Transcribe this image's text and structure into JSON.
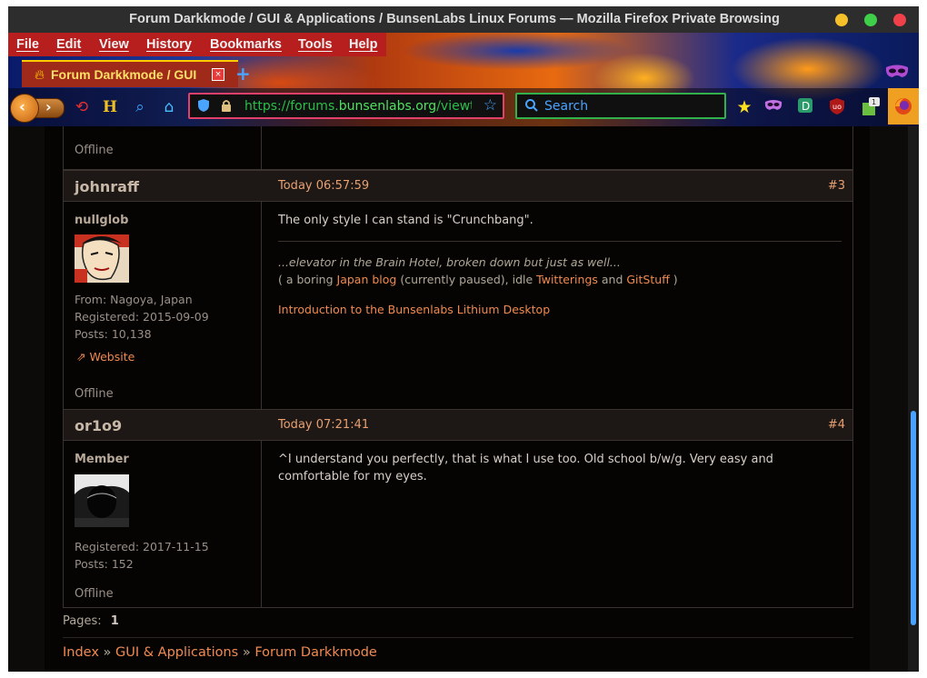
{
  "window": {
    "title": "Forum Darkkmode / GUI & Applications / BunsenLabs Linux Forums — Mozilla Firefox Private Browsing"
  },
  "menubar": {
    "items": [
      "File",
      "Edit",
      "View",
      "History",
      "Bookmarks",
      "Tools",
      "Help"
    ]
  },
  "tab": {
    "label": "Forum Darkkmode / GUI",
    "close": "×",
    "new_tab": "+"
  },
  "toolbar": {
    "url": {
      "scheme": "https://",
      "prefix": "forums.",
      "host": "bunsenlabs.org",
      "path": "/viewtopic.php"
    },
    "search_placeholder": "Search",
    "badge_count": "1",
    "icons": [
      "back-icon",
      "forward-icon",
      "redirect-icon",
      "h-icon",
      "magnifier-icon",
      "home-icon",
      "shield-icon",
      "lock-icon",
      "star-outline-icon",
      "search-icon",
      "star-icon",
      "mask-icon",
      "download-icon",
      "ublock-icon",
      "puzzle-icon",
      "firefox-icon",
      "private-mask-icon"
    ]
  },
  "posts": [
    {
      "offline_only": true,
      "status": "Offline"
    },
    {
      "author": "johnraff",
      "time": "Today 06:57:59",
      "num": "#3",
      "rank": "nullglob",
      "from": "From: Nagoya, Japan",
      "registered": "Registered: 2015-09-09",
      "posts": "Posts: 10,138",
      "website": "Website",
      "status": "Offline",
      "message": "The only style I can stand is \"Crunchbang\".",
      "signature": {
        "line1": "...elevator in the Brain Hotel, broken down but just as well...",
        "line2_prefix": "( a boring ",
        "link1": "Japan blog",
        "line2_mid1": " (currently paused), idle ",
        "link2": "Twitterings",
        "line2_mid2": " and ",
        "link3": "GitStuff",
        "line2_suffix": " )",
        "link4": "Introduction to the Bunsenlabs Lithium Desktop"
      }
    },
    {
      "author": "or1o9",
      "time": "Today 07:21:41",
      "num": "#4",
      "rank": "Member",
      "registered": "Registered: 2017-11-15",
      "posts": "Posts: 152",
      "status": "Offline",
      "message": "^I understand you perfectly, that is what I use too. Old school b/w/g. Very easy and comfortable for my eyes."
    }
  ],
  "footer": {
    "pages_label": "Pages:",
    "page_current": "1",
    "crumbs": [
      "Index",
      "GUI & Applications",
      "Forum Darkkmode"
    ],
    "crumb_sep": "»"
  },
  "colors": {
    "accent_link": "#f08a50",
    "url_green": "#50e060",
    "search_blue": "#4aa3ff",
    "menu_red": "#b71e1e"
  }
}
